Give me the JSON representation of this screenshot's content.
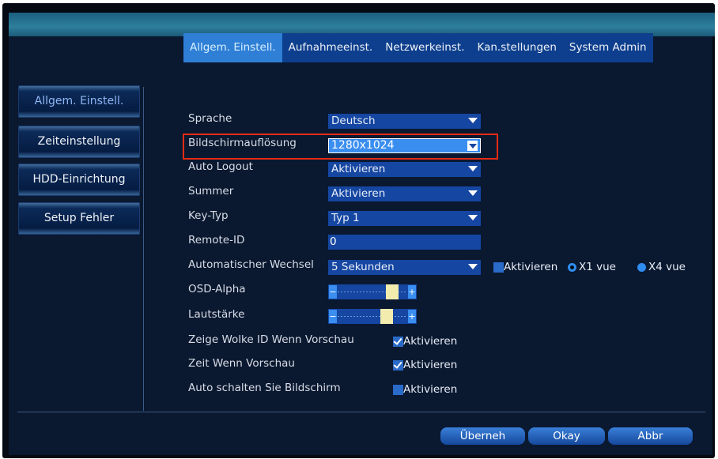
{
  "tabs": [
    "Allgem. Einstell.",
    "Aufnahmeeinst.",
    "Netzwerkeinst.",
    "Kan.stellungen",
    "System Admin"
  ],
  "sidebar": [
    "Allgem. Einstell.",
    "Zeiteinstellung",
    "HDD-Einrichtung",
    "Setup Fehler"
  ],
  "fields": {
    "sprache": {
      "label": "Sprache",
      "value": "Deutsch"
    },
    "aufloesung": {
      "label": "Bildschirmauflösung",
      "value": "1280x1024"
    },
    "autologout": {
      "label": "Auto Logout",
      "value": "Aktivieren"
    },
    "summer": {
      "label": "Summer",
      "value": "Aktivieren"
    },
    "keytyp": {
      "label": "Key-Typ",
      "value": "Typ 1"
    },
    "remoteid": {
      "label": "Remote-ID",
      "value": "0"
    },
    "wechsel": {
      "label": "Automatischer Wechsel",
      "value": "5 Sekunden",
      "check_label": "Aktivieren",
      "radio1": "X1 vue",
      "radio2": "X4 vue"
    },
    "osd": {
      "label": "OSD-Alpha",
      "level": 0.85
    },
    "laut": {
      "label": "Lautstärke",
      "level": 0.75
    },
    "wolke": {
      "label": "Zeige Wolke ID Wenn Vorschau",
      "check_label": "Aktivieren"
    },
    "zeit": {
      "label": "Zeit Wenn Vorschau",
      "check_label": "Aktivieren"
    },
    "autoschalten": {
      "label": "Auto schalten Sie Bildschirm",
      "check_label": "Aktivieren"
    }
  },
  "buttons": {
    "apply": "Überneh",
    "ok": "Okay",
    "cancel": "Abbr"
  },
  "colors": {
    "highlight": "#e52b14",
    "accent": "#2f7fd6",
    "field": "#1546a2"
  }
}
